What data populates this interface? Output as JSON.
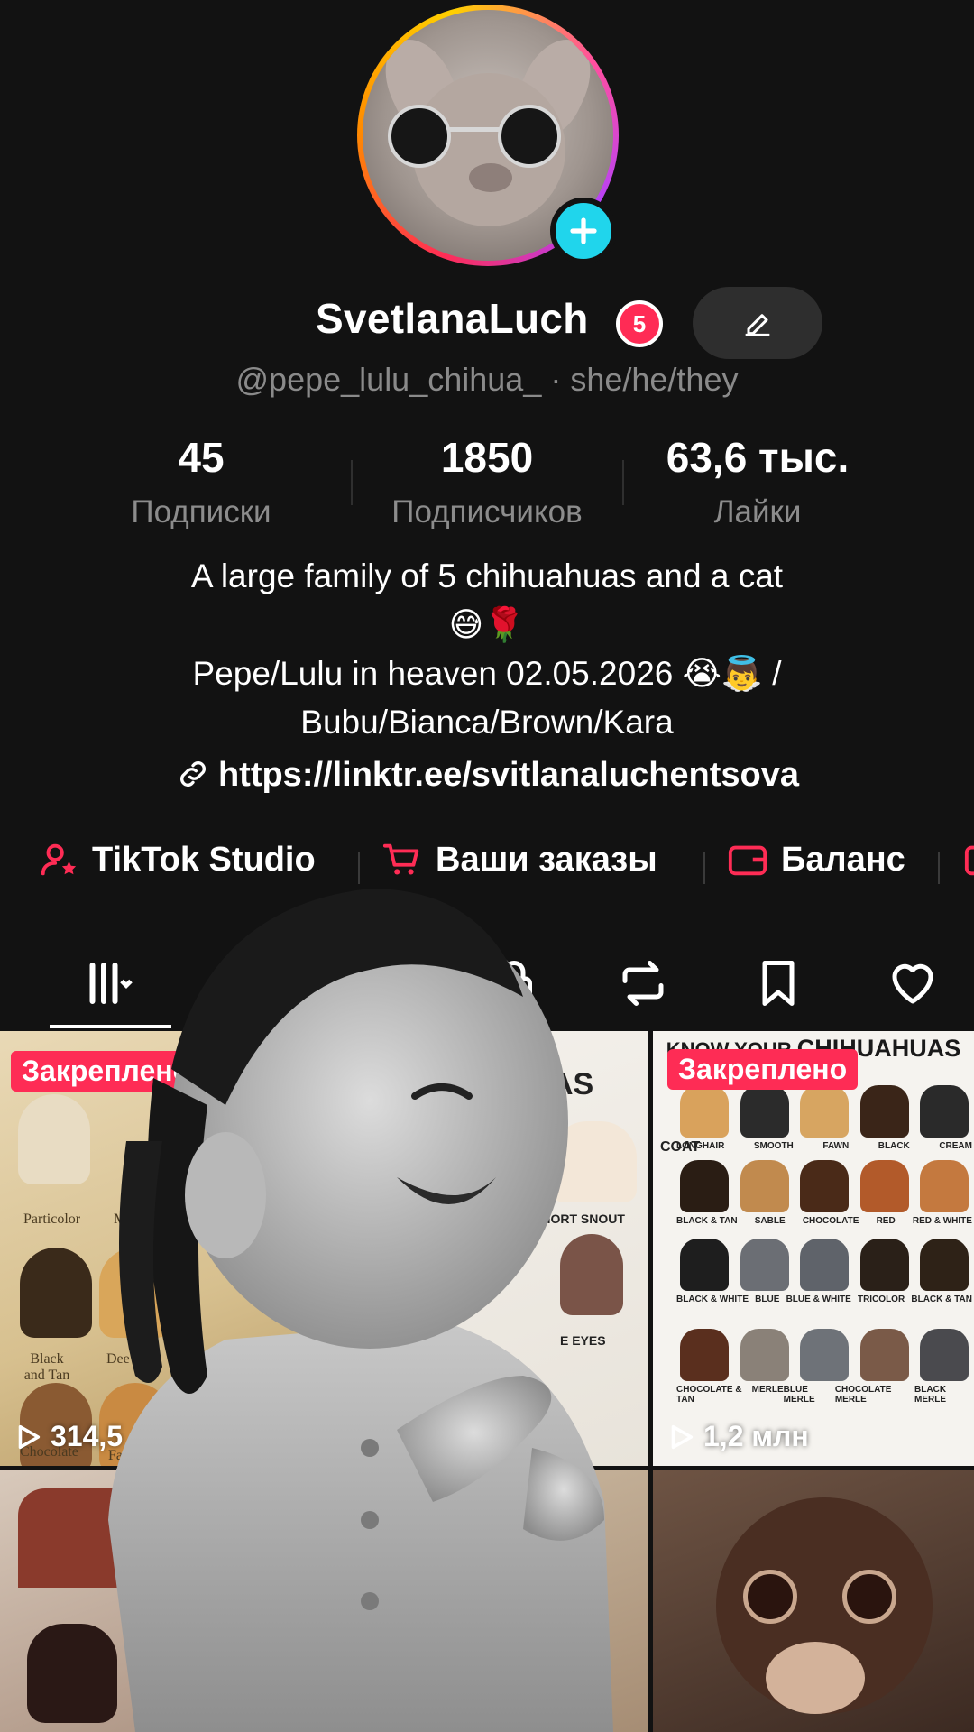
{
  "profile": {
    "display_name": "SvetlanaLuch",
    "notification_count": "5",
    "handle_line": "@pepe_lulu_chihua_ · she/he/they",
    "stats": [
      {
        "value": "45",
        "label": "Подписки"
      },
      {
        "value": "1850",
        "label": "Подписчиков"
      },
      {
        "value": "63,6 тыс.",
        "label": "Лайки"
      }
    ],
    "bio": {
      "line1": "A large family of 5 chihuahuas and a cat",
      "line2": "😅🌹",
      "line3": "Pepe/Lulu in heaven 02.05.2026 😭👼 /",
      "line4": "Bubu/Bianca/Brown/Kara"
    },
    "link": "https://linktr.ee/svitlanaluchentsova"
  },
  "quick_links": [
    {
      "label": "TikTok Studio",
      "icon": "user-star-icon"
    },
    {
      "label": "Ваши заказы",
      "icon": "cart-icon"
    },
    {
      "label": "Баланс",
      "icon": "wallet-icon"
    }
  ],
  "tabs": [
    {
      "name": "videos-grid",
      "icon": "grid-icon",
      "active": true
    },
    {
      "name": "private",
      "icon": "lock-icon"
    },
    {
      "name": "reposts",
      "icon": "repost-icon"
    },
    {
      "name": "favorites",
      "icon": "bookmark-icon"
    },
    {
      "name": "liked",
      "icon": "heart-icon"
    }
  ],
  "grid": {
    "pinned_label": "Закреплено",
    "videos": [
      {
        "pinned": true,
        "views": "314,5"
      },
      {
        "pinned": true,
        "views": ""
      },
      {
        "pinned": true,
        "views": "1,2 млн"
      },
      {
        "pinned": false,
        "views": ""
      },
      {
        "pinned": false,
        "views": ""
      },
      {
        "pinned": false,
        "views": ""
      }
    ],
    "cell1_labels": [
      "Particolor",
      "Me",
      "Black and Tan",
      "Dee Fav",
      "Chocolate",
      "Fav"
    ],
    "cell2_labels": [
      "AS",
      "SHORT SNOUT",
      "E EYES"
    ],
    "cell3": {
      "title_small": "KNOW YOUR",
      "title_big": "CHIHUAHUAS",
      "side_label": "COAT",
      "rows": [
        [
          "LONGHAIR",
          "SMOOTH",
          "FAWN",
          "BLACK",
          "CREAM"
        ],
        [
          "BLACK & TAN",
          "SABLE",
          "CHOCOLATE",
          "RED",
          "RED & WHITE"
        ],
        [
          "BLACK & WHITE",
          "BLUE",
          "BLUE & WHITE",
          "TRICOLOR",
          "BLACK & TAN"
        ],
        [
          "CHOCOLATE & TAN",
          "MERLE",
          "BLUE MERLE",
          "CHOCOLATE MERLE",
          "BLACK MERLE"
        ]
      ]
    }
  },
  "colors": {
    "background": "#121212",
    "accent": "#fe2c55",
    "add_badge": "#20d5ec",
    "muted_text": "#8a8a8a"
  }
}
